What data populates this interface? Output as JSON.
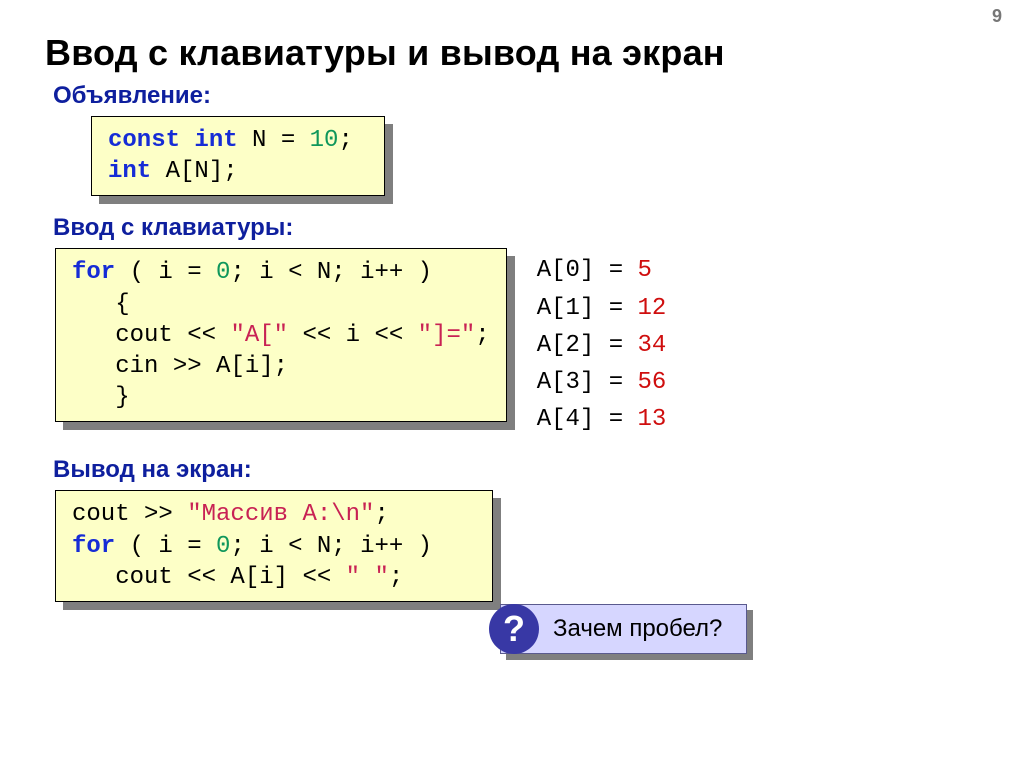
{
  "page_number": "9",
  "title": "Ввод с клавиатуры и вывод на экран",
  "sections": {
    "declaration": "Объявление:",
    "input": "Ввод с клавиатуры:",
    "output": "Вывод на экран:"
  },
  "code": {
    "decl_kw1": "const int",
    "decl_var": " N ",
    "decl_eq": "= ",
    "decl_val": "10",
    "decl_semi": ";",
    "decl_kw2": "int",
    "decl_arr": " A[N];",
    "for_kw": "for",
    "for_open": " ( i ",
    "for_eq": "= ",
    "for_zero": "0",
    "for_cond": "; i < N; i++ )",
    "for_brace_o": "   {",
    "for_cout": "   cout << ",
    "for_str1": "\"A[\"",
    "for_mid1": " << i << ",
    "for_str2": "\"]=\"",
    "for_semi1": ";",
    "for_cin": "   cin >> A[i];",
    "for_brace_c": "   }",
    "out_cout": "cout >> ",
    "out_str": "\"Массив A:\\n\"",
    "out_semi": ";",
    "out_for_kw": "for",
    "out_for": " ( i ",
    "out_eq": "= ",
    "out_zero": "0",
    "out_cond": "; i < N; i++ )",
    "out_line": "   cout << A[i] << ",
    "out_space": "\" \"",
    "out_semi2": ";"
  },
  "sample": [
    {
      "k": "A[0] = ",
      "v": "5"
    },
    {
      "k": "A[1] = ",
      "v": "12"
    },
    {
      "k": "A[2] = ",
      "v": "34"
    },
    {
      "k": "A[3] = ",
      "v": "56"
    },
    {
      "k": "A[4] = ",
      "v": "13"
    }
  ],
  "callout": {
    "mark": "?",
    "text": "Зачем пробел?"
  }
}
